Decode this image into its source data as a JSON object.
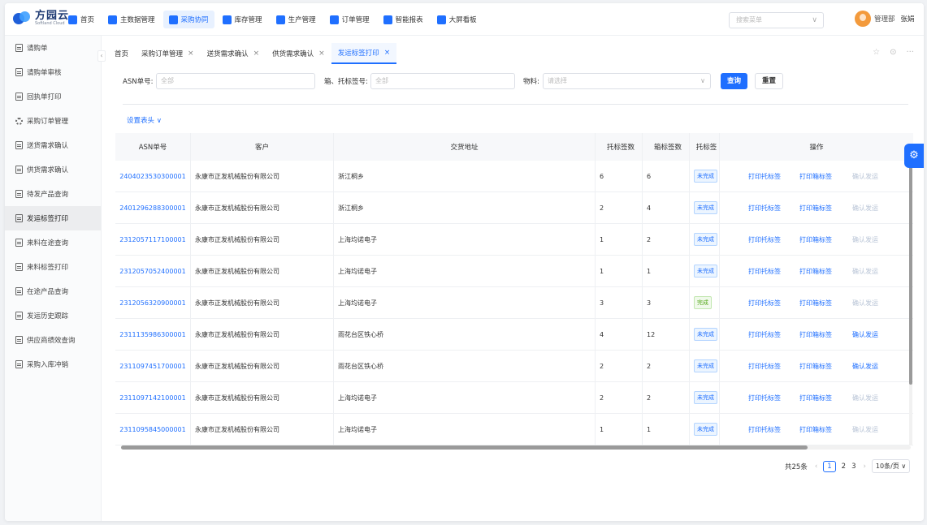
{
  "brand": {
    "name_cn": "方园云",
    "name_en": "Softland Cloud"
  },
  "nav": [
    {
      "label": "首页",
      "icon": "home-icon",
      "color": "#1f6fff",
      "active": false
    },
    {
      "label": "主数据管理",
      "icon": "database-icon",
      "color": "#1f6fff",
      "active": false
    },
    {
      "label": "采购协同",
      "icon": "cart-icon",
      "color": "#1f6fff",
      "active": true
    },
    {
      "label": "库存管理",
      "icon": "warehouse-icon",
      "color": "#1f6fff",
      "active": false
    },
    {
      "label": "生产管理",
      "icon": "factory-icon",
      "color": "#1f6fff",
      "active": false
    },
    {
      "label": "订单管理",
      "icon": "order-icon",
      "color": "#1f6fff",
      "active": false
    },
    {
      "label": "智能报表",
      "icon": "report-icon",
      "color": "#1f6fff",
      "active": false
    },
    {
      "label": "大屏看板",
      "icon": "dashboard-icon",
      "color": "#1f6fff",
      "active": false
    }
  ],
  "header": {
    "search_placeholder": "搜索菜单",
    "role": "管理部",
    "user": "张娟"
  },
  "sidebar": [
    {
      "label": "请购单",
      "icon": "document-icon",
      "active": false
    },
    {
      "label": "请购单审核",
      "icon": "document-icon",
      "active": false
    },
    {
      "label": "回执单打印",
      "icon": "document-icon",
      "active": false
    },
    {
      "label": "采购订单管理",
      "icon": "gear-icon",
      "active": false
    },
    {
      "label": "送货需求确认",
      "icon": "document-icon",
      "active": false
    },
    {
      "label": "供货需求确认",
      "icon": "document-icon",
      "active": false
    },
    {
      "label": "待发产品查询",
      "icon": "document-icon",
      "active": false
    },
    {
      "label": "发运标签打印",
      "icon": "document-icon",
      "active": true
    },
    {
      "label": "来料在途查询",
      "icon": "document-icon",
      "active": false
    },
    {
      "label": "来料标签打印",
      "icon": "document-icon",
      "active": false
    },
    {
      "label": "在途产品查询",
      "icon": "document-icon",
      "active": false
    },
    {
      "label": "发运历史跟踪",
      "icon": "document-icon",
      "active": false
    },
    {
      "label": "供应商绩效查询",
      "icon": "document-icon",
      "active": false
    },
    {
      "label": "采购入库冲销",
      "icon": "document-icon",
      "active": false
    }
  ],
  "tabs": [
    {
      "label": "首页",
      "closable": false,
      "active": false
    },
    {
      "label": "采购订单管理",
      "closable": true,
      "active": false
    },
    {
      "label": "送货需求确认",
      "closable": true,
      "active": false
    },
    {
      "label": "供货需求确认",
      "closable": true,
      "active": false
    },
    {
      "label": "发运标签打印",
      "closable": true,
      "active": true
    }
  ],
  "filters": {
    "asn_label": "ASN单号:",
    "asn_placeholder": "全部",
    "tag_label": "箱、托标签号:",
    "tag_placeholder": "全部",
    "material_label": "物料:",
    "material_placeholder": "请选择",
    "search_button": "查询",
    "reset_button": "重置"
  },
  "settings_link": "设置表头",
  "table": {
    "headers": {
      "asn": "ASN单号",
      "customer": "客户",
      "address": "交货地址",
      "tray": "托标签数",
      "box": "箱标签数",
      "status": "托标签",
      "ops": "操作"
    },
    "rows": [
      {
        "asn": "2404023530300001",
        "customer": "永康市正发机械股份有限公司",
        "address": "浙江桐乡",
        "tray": "6",
        "box": "6",
        "status": "未完成",
        "done": false,
        "op1": "打印托标签",
        "op2": "打印箱标签",
        "op3": "确认发运",
        "op3_enabled": false
      },
      {
        "asn": "2401296288300001",
        "customer": "永康市正发机械股份有限公司",
        "address": "浙江桐乡",
        "tray": "2",
        "box": "4",
        "status": "未完成",
        "done": false,
        "op1": "打印托标签",
        "op2": "打印箱标签",
        "op3": "确认发运",
        "op3_enabled": false
      },
      {
        "asn": "2312057117100001",
        "customer": "永康市正发机械股份有限公司",
        "address": "上海均诺电子",
        "tray": "1",
        "box": "2",
        "status": "未完成",
        "done": false,
        "op1": "打印托标签",
        "op2": "打印箱标签",
        "op3": "确认发运",
        "op3_enabled": false
      },
      {
        "asn": "2312057052400001",
        "customer": "永康市正发机械股份有限公司",
        "address": "上海均诺电子",
        "tray": "1",
        "box": "1",
        "status": "未完成",
        "done": false,
        "op1": "打印托标签",
        "op2": "打印箱标签",
        "op3": "确认发运",
        "op3_enabled": false
      },
      {
        "asn": "2312056320900001",
        "customer": "永康市正发机械股份有限公司",
        "address": "上海均诺电子",
        "tray": "3",
        "box": "3",
        "status": "完成",
        "done": true,
        "op1": "打印托标签",
        "op2": "打印箱标签",
        "op3": "确认发运",
        "op3_enabled": false
      },
      {
        "asn": "2311135986300001",
        "customer": "永康市正发机械股份有限公司",
        "address": "雨花台区铁心桥",
        "tray": "4",
        "box": "12",
        "status": "未完成",
        "done": false,
        "op1": "打印托标签",
        "op2": "打印箱标签",
        "op3": "确认发运",
        "op3_enabled": true
      },
      {
        "asn": "2311097451700001",
        "customer": "永康市正发机械股份有限公司",
        "address": "雨花台区铁心桥",
        "tray": "2",
        "box": "2",
        "status": "未完成",
        "done": false,
        "op1": "打印托标签",
        "op2": "打印箱标签",
        "op3": "确认发运",
        "op3_enabled": true
      },
      {
        "asn": "2311097142100001",
        "customer": "永康市正发机械股份有限公司",
        "address": "上海均诺电子",
        "tray": "2",
        "box": "2",
        "status": "未完成",
        "done": false,
        "op1": "打印托标签",
        "op2": "打印箱标签",
        "op3": "确认发运",
        "op3_enabled": false
      },
      {
        "asn": "2311095845000001",
        "customer": "永康市正发机械股份有限公司",
        "address": "上海均诺电子",
        "tray": "1",
        "box": "1",
        "status": "未完成",
        "done": false,
        "op1": "打印托标签",
        "op2": "打印箱标签",
        "op3": "确认发运",
        "op3_enabled": false
      }
    ]
  },
  "pagination": {
    "total": "共25条",
    "pages": [
      "1",
      "2",
      "3"
    ],
    "current": "1",
    "page_size": "10条/页"
  }
}
